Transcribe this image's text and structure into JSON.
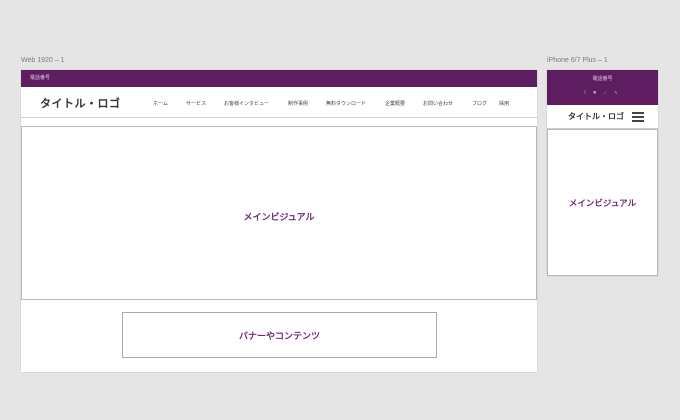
{
  "artboards": {
    "web_label": "Web 1920 – 1",
    "mobile_label": "iPhone 6/7 Plus – 1"
  },
  "web": {
    "phone": "電話番号",
    "logo": "タイトル・ロゴ",
    "nav": [
      "ホーム",
      "サービス",
      "お客様インタビュー",
      "制作事例",
      "無料ダウンロード",
      "企業概要",
      "お問い合わせ",
      "ブログ",
      "採用"
    ],
    "hero": "メインビジュアル",
    "banner": "バナーやコンテンツ"
  },
  "mobile": {
    "phone": "電話番号",
    "social": "f ♥ ✓ ✎",
    "logo": "タイトル・ロゴ",
    "hero": "メインビジュアル"
  },
  "colors": {
    "brand_purple": "#5e1d60",
    "accent_text": "#6f2673",
    "canvas": "#e5e5e5"
  }
}
